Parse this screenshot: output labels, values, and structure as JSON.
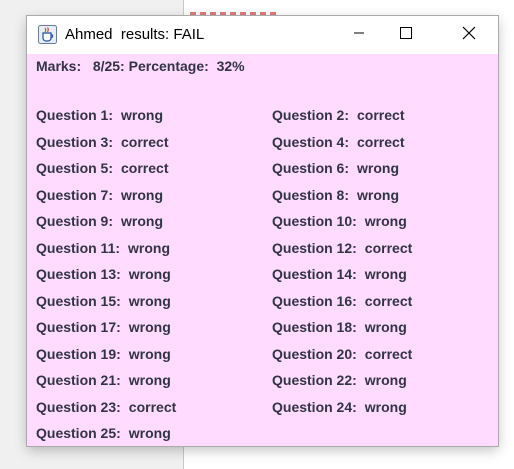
{
  "window": {
    "title": "Ahmed  results: FAIL"
  },
  "summary": {
    "marks_label": "Marks:",
    "marks_value": "8/25:",
    "percentage_label": "Percentage:",
    "percentage_value": "32%"
  },
  "questions": [
    {
      "label": "Question 1:",
      "result": "wrong"
    },
    {
      "label": "Question 2:",
      "result": "correct"
    },
    {
      "label": "Question 3:",
      "result": "correct"
    },
    {
      "label": "Question 4:",
      "result": "correct"
    },
    {
      "label": "Question 5:",
      "result": "correct"
    },
    {
      "label": "Question 6:",
      "result": "wrong"
    },
    {
      "label": "Question 7:",
      "result": "wrong"
    },
    {
      "label": "Question 8:",
      "result": "wrong"
    },
    {
      "label": "Question 9:",
      "result": "wrong"
    },
    {
      "label": "Question 10:",
      "result": "wrong"
    },
    {
      "label": "Question 11:",
      "result": "wrong"
    },
    {
      "label": "Question 12:",
      "result": "correct"
    },
    {
      "label": "Question 13:",
      "result": "wrong"
    },
    {
      "label": "Question 14:",
      "result": "wrong"
    },
    {
      "label": "Question 15:",
      "result": "wrong"
    },
    {
      "label": "Question 16:",
      "result": "correct"
    },
    {
      "label": "Question 17:",
      "result": "wrong"
    },
    {
      "label": "Question 18:",
      "result": "wrong"
    },
    {
      "label": "Question 19:",
      "result": "wrong"
    },
    {
      "label": "Question 20:",
      "result": "correct"
    },
    {
      "label": "Question 21:",
      "result": "wrong"
    },
    {
      "label": "Question 22:",
      "result": "wrong"
    },
    {
      "label": "Question 23:",
      "result": "correct"
    },
    {
      "label": "Question 24:",
      "result": "wrong"
    },
    {
      "label": "Question 25:",
      "result": "wrong"
    }
  ],
  "colors": {
    "content_background": "#ffdcff",
    "text": "#333344"
  },
  "icons": {
    "app": "java-cup-icon",
    "minimize": "minimize-icon",
    "maximize": "maximize-icon",
    "close": "close-icon"
  }
}
